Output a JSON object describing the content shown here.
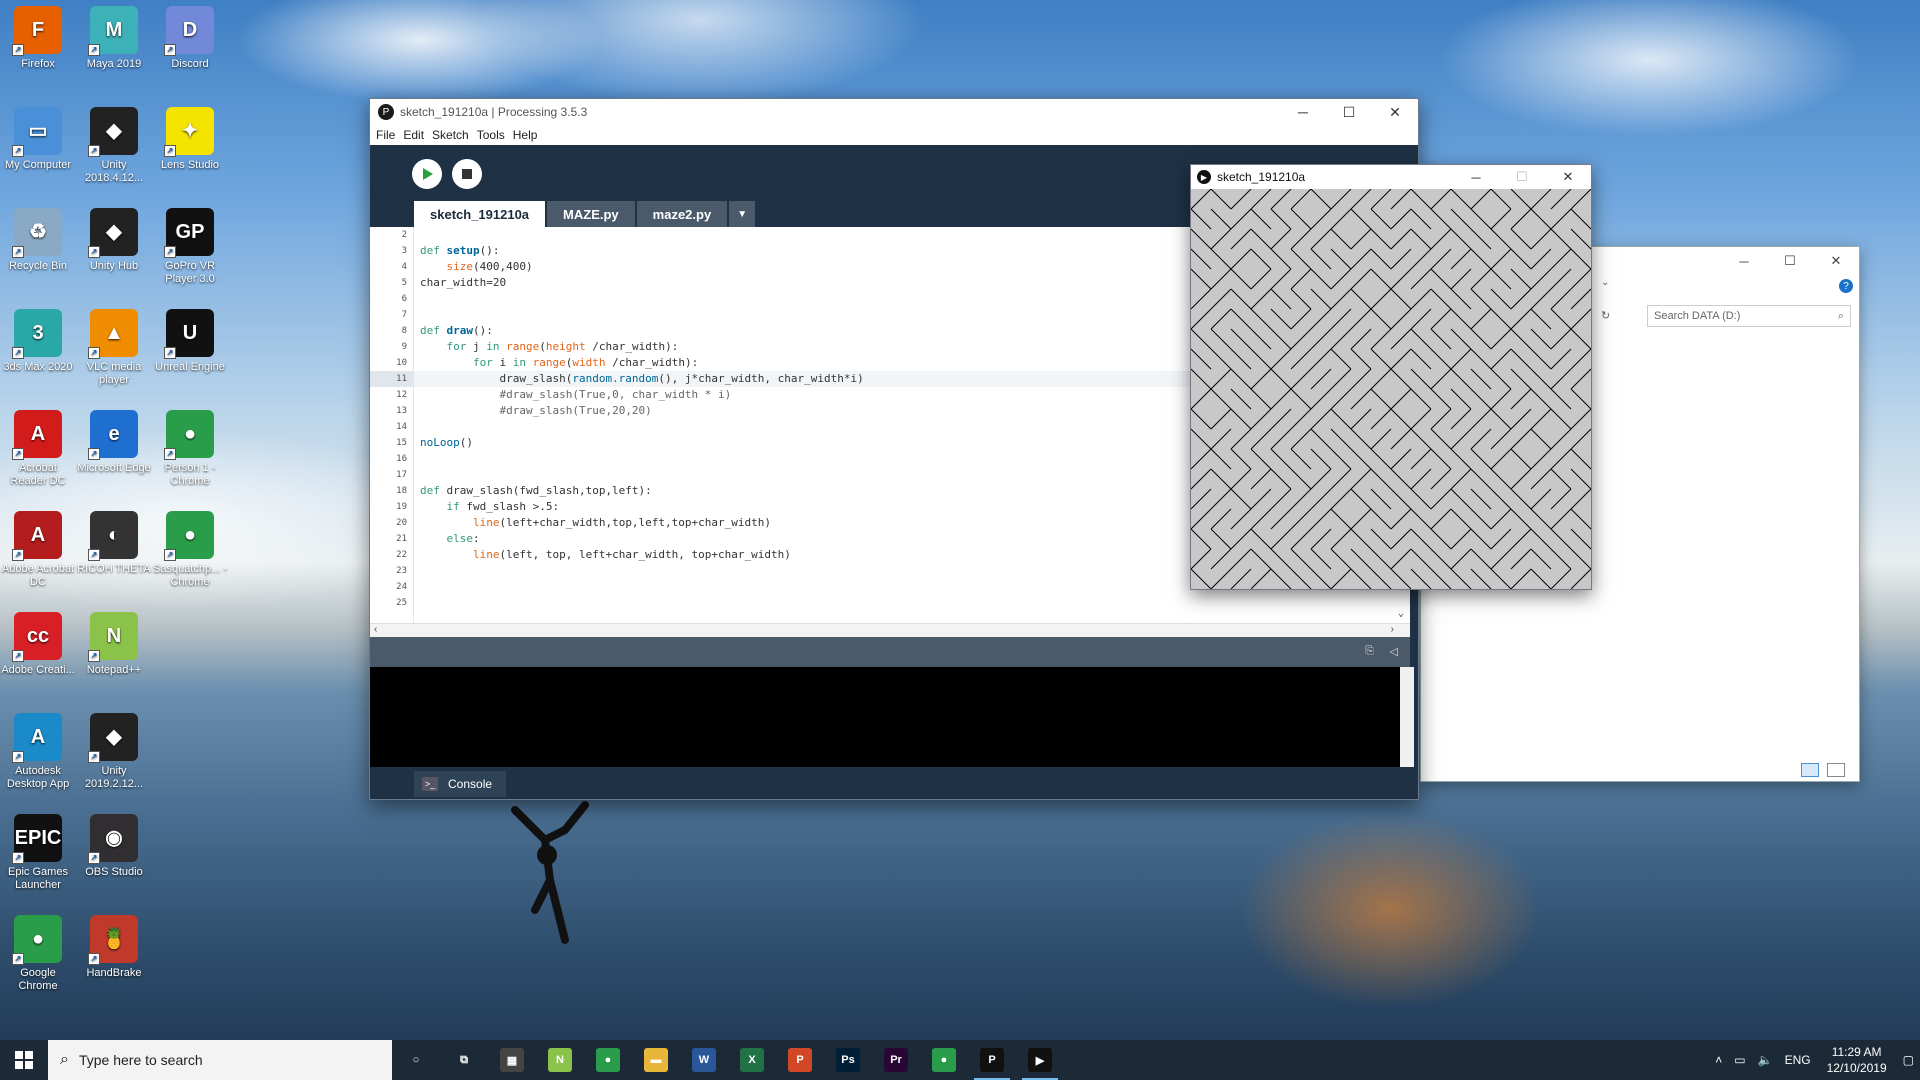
{
  "desktop": {
    "icons": [
      {
        "label": "Firefox",
        "icon": "firefox-icon",
        "color": "#e66000",
        "glyph": "F"
      },
      {
        "label": "Maya 2019",
        "icon": "maya-icon",
        "color": "#3cb1b8",
        "glyph": "M"
      },
      {
        "label": "Discord",
        "icon": "discord-icon",
        "color": "#7289da",
        "glyph": "D"
      },
      {
        "label": "My Computer",
        "icon": "computer-icon",
        "color": "#4a90d9",
        "glyph": "▭"
      },
      {
        "label": "Unity 2018.4.12...",
        "icon": "unity-icon",
        "color": "#222222",
        "glyph": "◆"
      },
      {
        "label": "Lens Studio",
        "icon": "lens-studio-icon",
        "color": "#f5e400",
        "glyph": "✦"
      },
      {
        "label": "Recycle Bin",
        "icon": "recycle-bin-icon",
        "color": "#8aa9c4",
        "glyph": "♻"
      },
      {
        "label": "Unity Hub",
        "icon": "unity-hub-icon",
        "color": "#222222",
        "glyph": "◆"
      },
      {
        "label": "GoPro VR Player 3.0",
        "icon": "gopro-icon",
        "color": "#111111",
        "glyph": "GP"
      },
      {
        "label": "3ds Max 2020",
        "icon": "3ds-max-icon",
        "color": "#2aa7a7",
        "glyph": "3"
      },
      {
        "label": "VLC media player",
        "icon": "vlc-icon",
        "color": "#f08c00",
        "glyph": "▲"
      },
      {
        "label": "Unreal Engine",
        "icon": "unreal-icon",
        "color": "#111111",
        "glyph": "U"
      },
      {
        "label": "Acrobat Reader DC",
        "icon": "acrobat-reader-icon",
        "color": "#d21b1b",
        "glyph": "A"
      },
      {
        "label": "Microsoft Edge",
        "icon": "edge-icon",
        "color": "#1f6fd1",
        "glyph": "e"
      },
      {
        "label": "Person 1 - Chrome",
        "icon": "chrome-icon",
        "color": "#2a9d4a",
        "glyph": "●"
      },
      {
        "label": "Adobe Acrobat DC",
        "icon": "acrobat-icon",
        "color": "#b31d1d",
        "glyph": "A"
      },
      {
        "label": "RICOH THETA",
        "icon": "ricoh-theta-icon",
        "color": "#333333",
        "glyph": "◐"
      },
      {
        "label": "Sasquatchp... - Chrome",
        "icon": "chrome-profile-icon",
        "color": "#2a9d4a",
        "glyph": "●"
      },
      {
        "label": "Adobe Creati...",
        "icon": "creative-cloud-icon",
        "color": "#d91f26",
        "glyph": "cc"
      },
      {
        "label": "Notepad++",
        "icon": "notepad-plus-icon",
        "color": "#8bc34a",
        "glyph": "N"
      },
      {
        "label": "",
        "icon": "blank-icon",
        "color": "transparent",
        "glyph": ""
      },
      {
        "label": "Autodesk Desktop App",
        "icon": "autodesk-icon",
        "color": "#1b8ac9",
        "glyph": "A"
      },
      {
        "label": "Unity 2019.2.12...",
        "icon": "unity-2019-icon",
        "color": "#222222",
        "glyph": "◆"
      },
      {
        "label": "",
        "icon": "blank-icon",
        "color": "transparent",
        "glyph": ""
      },
      {
        "label": "Epic Games Launcher",
        "icon": "epic-games-icon",
        "color": "#111111",
        "glyph": "EPIC"
      },
      {
        "label": "OBS Studio",
        "icon": "obs-icon",
        "color": "#302e31",
        "glyph": "◉"
      },
      {
        "label": "",
        "icon": "blank-icon",
        "color": "transparent",
        "glyph": ""
      },
      {
        "label": "Google Chrome",
        "icon": "google-chrome-icon",
        "color": "#2a9d4a",
        "glyph": "●"
      },
      {
        "label": "HandBrake",
        "icon": "handbrake-icon",
        "color": "#c0392b",
        "glyph": "🍍"
      }
    ]
  },
  "processing": {
    "title": "sketch_191210a | Processing 3.5.3",
    "menu": [
      "File",
      "Edit",
      "Sketch",
      "Tools",
      "Help"
    ],
    "tabs": [
      "sketch_191210a",
      "MAZE.py",
      "maze2.py"
    ],
    "tab_more": "▼",
    "line_numbers": [
      "2",
      "3",
      "4",
      "5",
      "6",
      "7",
      "8",
      "9",
      "10",
      "11",
      "12",
      "13",
      "14",
      "15",
      "16",
      "17",
      "18",
      "19",
      "20",
      "21",
      "22",
      "23",
      "24",
      "25"
    ],
    "highlight_line": "11",
    "console_label": "Console"
  },
  "sketch_window": {
    "title": "sketch_191210a"
  },
  "explorer": {
    "search_placeholder": "Search DATA (D:)"
  },
  "taskbar": {
    "search_placeholder": "Type here to search",
    "apps": [
      {
        "icon": "cortana-icon",
        "glyph": "○",
        "color": "transparent"
      },
      {
        "icon": "task-view-icon",
        "glyph": "⧉",
        "color": "transparent"
      },
      {
        "icon": "calculator-icon",
        "glyph": "▦",
        "color": "#444444"
      },
      {
        "icon": "notepad-plus-taskbar-icon",
        "glyph": "N",
        "color": "#8bc34a"
      },
      {
        "icon": "chrome-taskbar-icon",
        "glyph": "●",
        "color": "#2a9d4a"
      },
      {
        "icon": "file-explorer-icon",
        "glyph": "▬",
        "color": "#e8b73a"
      },
      {
        "icon": "word-icon",
        "glyph": "W",
        "color": "#2b579a"
      },
      {
        "icon": "excel-icon",
        "glyph": "X",
        "color": "#217346"
      },
      {
        "icon": "powerpoint-icon",
        "glyph": "P",
        "color": "#d24726"
      },
      {
        "icon": "photoshop-icon",
        "glyph": "Ps",
        "color": "#001e36"
      },
      {
        "icon": "premiere-icon",
        "glyph": "Pr",
        "color": "#2a0634"
      },
      {
        "icon": "chrome-profile-taskbar-icon",
        "glyph": "●",
        "color": "#2a9d4a"
      },
      {
        "icon": "processing-taskbar-icon",
        "glyph": "P",
        "color": "#111111"
      },
      {
        "icon": "sketch-run-taskbar-icon",
        "glyph": "▶",
        "color": "#111111"
      }
    ],
    "language": "ENG",
    "time": "11:29 AM",
    "date": "12/10/2019"
  }
}
